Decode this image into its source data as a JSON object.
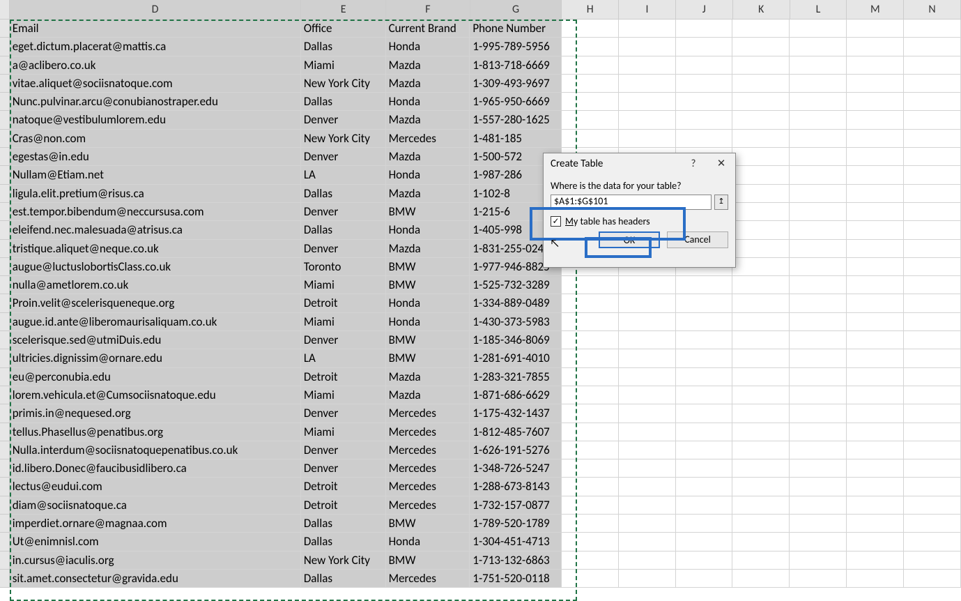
{
  "columns": [
    "D",
    "E",
    "F",
    "G",
    "H",
    "I",
    "J",
    "K",
    "L",
    "M",
    "N"
  ],
  "headers": {
    "D": "Email",
    "E": "Office",
    "F": "Current Brand",
    "G": "Phone Number"
  },
  "rows": [
    {
      "D": "eget.dictum.placerat@mattis.ca",
      "E": "Dallas",
      "F": "Honda",
      "G": "1-995-789-5956"
    },
    {
      "D": "a@aclibero.co.uk",
      "E": "Miami",
      "F": "Mazda",
      "G": "1-813-718-6669"
    },
    {
      "D": "vitae.aliquet@sociisnatoque.com",
      "E": "New York City",
      "F": "Mazda",
      "G": "1-309-493-9697"
    },
    {
      "D": "Nunc.pulvinar.arcu@conubianostraper.edu",
      "E": "Dallas",
      "F": "Honda",
      "G": "1-965-950-6669"
    },
    {
      "D": "natoque@vestibulumlorem.edu",
      "E": "Denver",
      "F": "Mazda",
      "G": "1-557-280-1625"
    },
    {
      "D": "Cras@non.com",
      "E": "New York City",
      "F": "Mercedes",
      "G": "1-481-185"
    },
    {
      "D": "egestas@in.edu",
      "E": "Denver",
      "F": "Mazda",
      "G": "1-500-572"
    },
    {
      "D": "Nullam@Etiam.net",
      "E": "LA",
      "F": "Honda",
      "G": "1-987-286"
    },
    {
      "D": "ligula.elit.pretium@risus.ca",
      "E": "Dallas",
      "F": "Mazda",
      "G": "1-102-8"
    },
    {
      "D": "est.tempor.bibendum@neccursusa.com",
      "E": "Denver",
      "F": "BMW",
      "G": "1-215-6"
    },
    {
      "D": "eleifend.nec.malesuada@atrisus.ca",
      "E": "Dallas",
      "F": "Honda",
      "G": "1-405-998"
    },
    {
      "D": "tristique.aliquet@neque.co.uk",
      "E": "Denver",
      "F": "Mazda",
      "G": "1-831-255-0242"
    },
    {
      "D": "augue@luctuslobortisClass.co.uk",
      "E": "Toronto",
      "F": "BMW",
      "G": "1-977-946-8825"
    },
    {
      "D": "nulla@ametlorem.co.uk",
      "E": "Miami",
      "F": "BMW",
      "G": "1-525-732-3289"
    },
    {
      "D": "Proin.velit@scelerisqueneque.org",
      "E": "Detroit",
      "F": "Honda",
      "G": "1-334-889-0489"
    },
    {
      "D": "augue.id.ante@liberomaurisaliquam.co.uk",
      "E": "Miami",
      "F": "Honda",
      "G": "1-430-373-5983"
    },
    {
      "D": "scelerisque.sed@utmiDuis.edu",
      "E": "Denver",
      "F": "BMW",
      "G": "1-185-346-8069"
    },
    {
      "D": "ultricies.dignissim@ornare.edu",
      "E": "LA",
      "F": "BMW",
      "G": "1-281-691-4010"
    },
    {
      "D": "eu@perconubia.edu",
      "E": "Detroit",
      "F": "Mazda",
      "G": "1-283-321-7855"
    },
    {
      "D": "lorem.vehicula.et@Cumsociisnatoque.edu",
      "E": "Miami",
      "F": "Mazda",
      "G": "1-871-686-6629"
    },
    {
      "D": "primis.in@nequesed.org",
      "E": "Denver",
      "F": "Mercedes",
      "G": "1-175-432-1437"
    },
    {
      "D": "tellus.Phasellus@penatibus.org",
      "E": "Miami",
      "F": "Mercedes",
      "G": "1-812-485-7607"
    },
    {
      "D": "Nulla.interdum@sociisnatoquepenatibus.co.uk",
      "E": "Denver",
      "F": "Mercedes",
      "G": "1-626-191-5276"
    },
    {
      "D": "id.libero.Donec@faucibusidlibero.ca",
      "E": "Denver",
      "F": "Mercedes",
      "G": "1-348-726-5247"
    },
    {
      "D": "lectus@eudui.com",
      "E": "Detroit",
      "F": "Mercedes",
      "G": "1-288-673-8143"
    },
    {
      "D": "diam@sociisnatoque.ca",
      "E": "Detroit",
      "F": "Mercedes",
      "G": "1-732-157-0877"
    },
    {
      "D": "imperdiet.ornare@magnaa.com",
      "E": "Dallas",
      "F": "BMW",
      "G": "1-789-520-1789"
    },
    {
      "D": "Ut@enimnisl.com",
      "E": "Dallas",
      "F": "Honda",
      "G": "1-304-451-4713"
    },
    {
      "D": "in.cursus@iaculis.org",
      "E": "New York City",
      "F": "BMW",
      "G": "1-713-132-6863"
    },
    {
      "D": "sit.amet.consectetur@gravida.edu",
      "E": "Dallas",
      "F": "Mercedes",
      "G": "1-751-520-0118"
    }
  ],
  "dialog": {
    "title": "Create Table",
    "prompt": "Where is the data for your table?",
    "range_value": "$A$1:$G$101",
    "headers_label": "My table has headers",
    "headers_label_first": "M",
    "headers_label_rest": "y table has headers",
    "headers_checked": true,
    "ok": "OK",
    "cancel": "Cancel",
    "help": "?",
    "close": "✕",
    "range_picker_icon": "↥"
  }
}
